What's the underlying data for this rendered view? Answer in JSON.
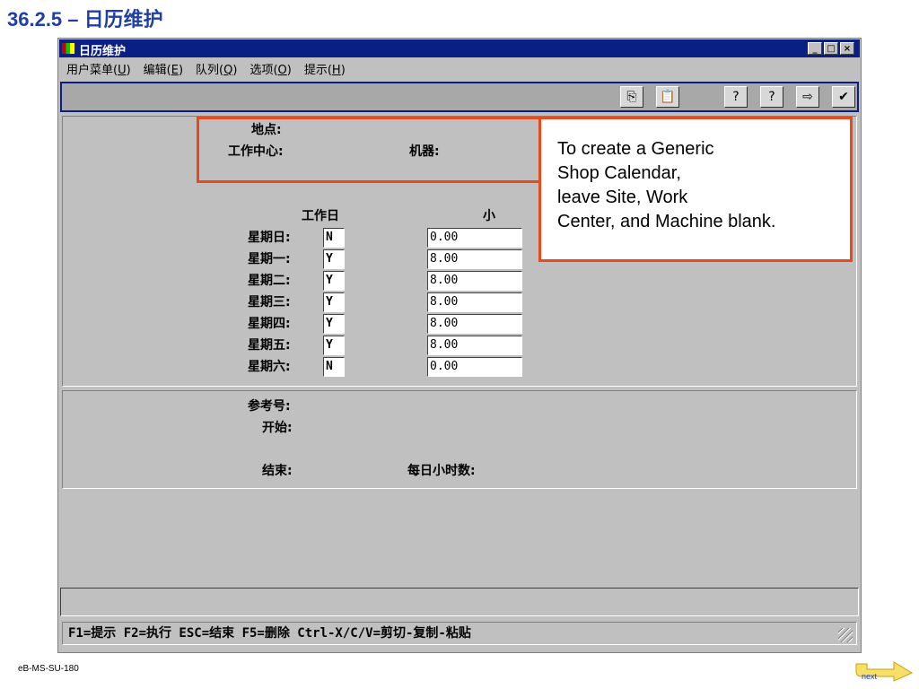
{
  "slide_title": "36.2.5 – 日历维护",
  "window": {
    "title": "日历维护",
    "controls": [
      "_",
      "□",
      "×"
    ]
  },
  "menu": [
    {
      "label": "用户菜单(",
      "key": "U",
      "tail": ")"
    },
    {
      "label": "编辑(",
      "key": "E",
      "tail": ")"
    },
    {
      "label": "队列(",
      "key": "Q",
      "tail": ")"
    },
    {
      "label": "选项(",
      "key": "O",
      "tail": ")"
    },
    {
      "label": "提示(",
      "key": "H",
      "tail": ")"
    }
  ],
  "toolbar": {
    "icons": [
      "copy-icon",
      "paste-icon",
      "help-icon",
      "lookup-icon",
      "go-icon",
      "next-icon"
    ],
    "glyphs": [
      "⎘",
      "📋",
      "?",
      "?",
      "⇨",
      "✔"
    ]
  },
  "header_fields": {
    "site_label": "地点:",
    "work_center_label": "工作中心:",
    "machine_label": "机器:"
  },
  "schedule": {
    "workday_header": "工作日",
    "hours_header": "小",
    "days": [
      {
        "label": "星期日:",
        "workday": "N",
        "hours": "0.00"
      },
      {
        "label": "星期一:",
        "workday": "Y",
        "hours": "8.00"
      },
      {
        "label": "星期二:",
        "workday": "Y",
        "hours": "8.00"
      },
      {
        "label": "星期三:",
        "workday": "Y",
        "hours": "8.00"
      },
      {
        "label": "星期四:",
        "workday": "Y",
        "hours": "8.00"
      },
      {
        "label": "星期五:",
        "workday": "Y",
        "hours": "8.00"
      },
      {
        "label": "星期六:",
        "workday": "N",
        "hours": "0.00"
      }
    ]
  },
  "reference": {
    "ref_label": "参考号:",
    "start_label": "开始:",
    "end_label": "结束:",
    "daily_hours_label": "每日小时数:"
  },
  "status_bar": "F1=提示 F2=执行 ESC=结束 F5=删除 Ctrl-X/C/V=剪切-复制-粘贴",
  "callout": {
    "lines": [
      "To create a Generic",
      "Shop Calendar,",
      "leave Site,  Work",
      "Center, and Machine blank."
    ]
  },
  "footer_code": "eB-MS-SU-180",
  "next_label": "next",
  "colors": {
    "accent_box": "#e84a1c",
    "title_blue": "#1f3fa8",
    "titlebar": "#0a1f84"
  }
}
